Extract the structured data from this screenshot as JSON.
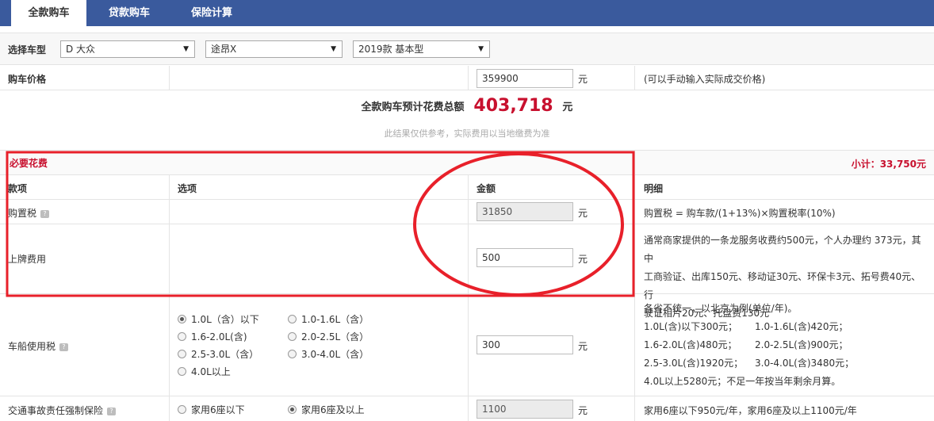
{
  "tabs": [
    "全款购车",
    "贷款购车",
    "保险计算"
  ],
  "car_select": {
    "label": "选择车型",
    "brand": "D 大众",
    "model": "途昂X",
    "trim": "2019款 基本型"
  },
  "price": {
    "label": "购车价格",
    "value": "359900",
    "unit": "元",
    "note": "(可以手动输入实际成交价格)"
  },
  "total": {
    "label": "全款购车预计花费总额",
    "value": "403,718",
    "unit": "元",
    "note": "此结果仅供参考，实际费用以当地缴费为准"
  },
  "required": {
    "title": "必要花费",
    "subtotal": "小计：33,750元",
    "headers": {
      "item": "款项",
      "option": "选项",
      "amount": "金额",
      "detail": "明细"
    },
    "purchase_tax": {
      "label": "购置税",
      "value": "31850",
      "unit": "元",
      "detail": "购置税 = 购车款/(1+13%)×购置税率(10%)"
    },
    "plate_fee": {
      "label": "上牌费用",
      "value": "500",
      "unit": "元",
      "detail_lines": [
        "通常商家提供的一条龙服务收费约500元，个人办理约 373元，其中",
        "工商验证、出库150元、移动证30元、环保卡3元、拓号费40元、行",
        "驶证相片20元、托盘费130元"
      ]
    },
    "vehicle_tax": {
      "label": "车船使用税",
      "value": "300",
      "unit": "元",
      "options": [
        "1.0L（含）以下",
        "1.0-1.6L（含）",
        "1.6-2.0L(含)",
        "2.0-2.5L（含）",
        "2.5-3.0L（含）",
        "3.0-4.0L（含）",
        "4.0L以上"
      ],
      "selected_index": 0,
      "detail_lines": [
        "各省不统一，以北京为例(单位/年)。",
        "1.0L(含)以下300元；",
        "1.0-1.6L(含)420元；",
        "1.6-2.0L(含)480元；",
        "2.0-2.5L(含)900元；",
        "2.5-3.0L(含)1920元；",
        "3.0-4.0L(含)3480元；",
        "4.0L以上5280元；不足一年按当年剩余月算。"
      ]
    },
    "compulsory_insurance": {
      "label": "交通事故责任强制保险",
      "value": "1100",
      "unit": "元",
      "options": [
        "家用6座以下",
        "家用6座及以上"
      ],
      "selected_index": 1,
      "detail": "家用6座以下950元/年，家用6座及以上1100元/年"
    }
  },
  "colors": {
    "tab_bar": "#3a5a9d",
    "accent_red": "#c8102e",
    "highlight_annotation": "#e8202a"
  }
}
